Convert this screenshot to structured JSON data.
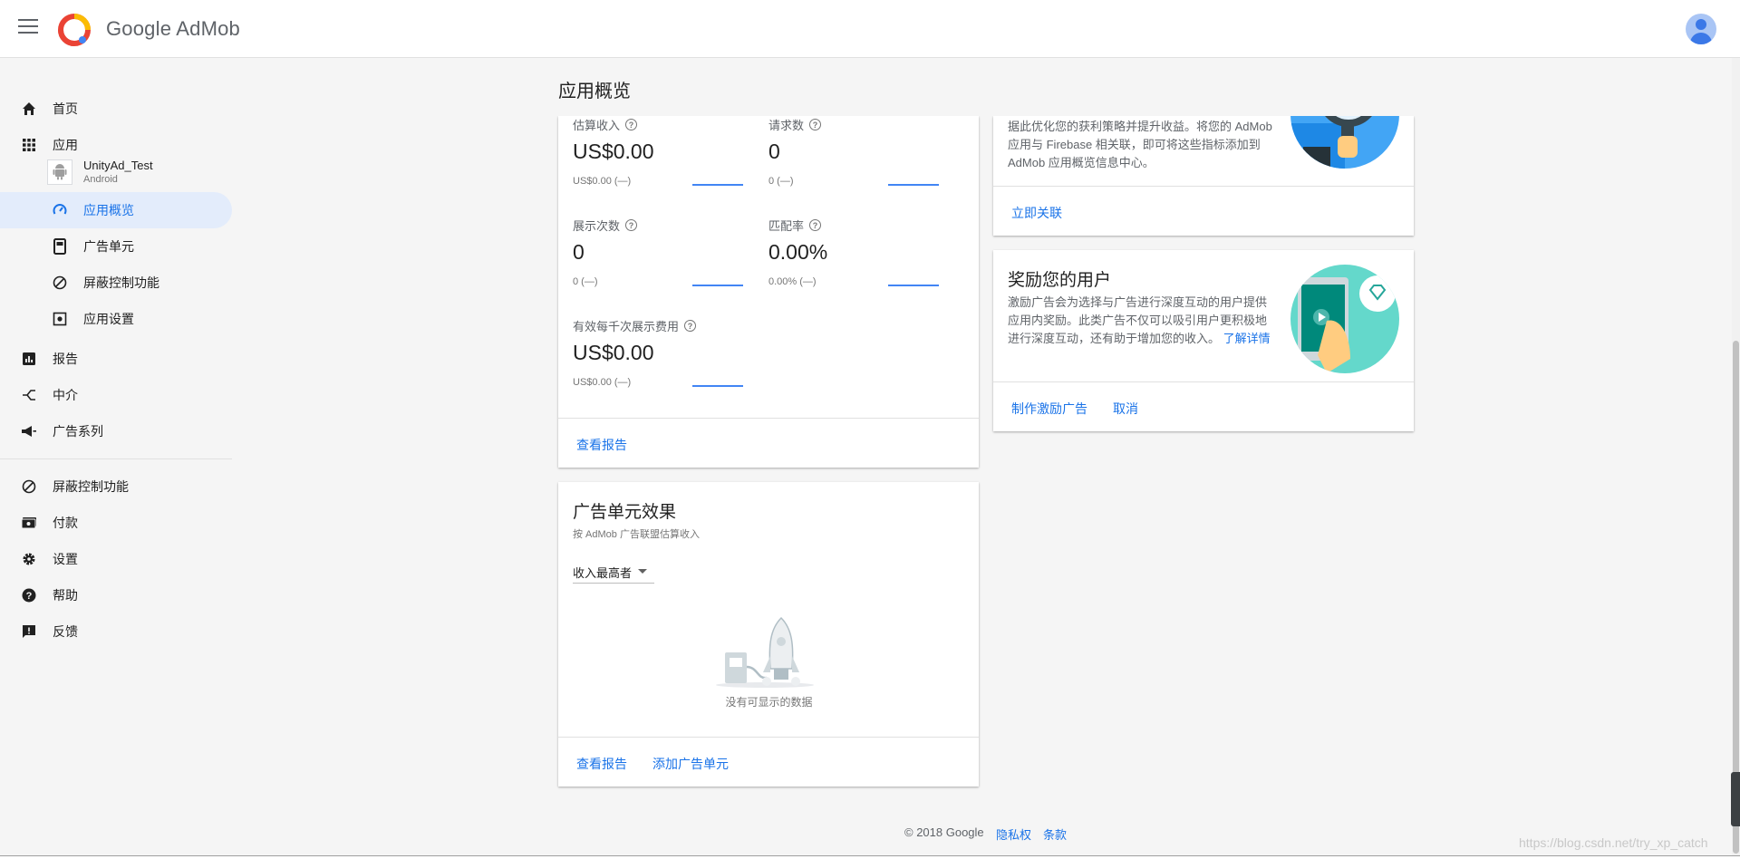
{
  "topbar": {
    "brand_google": "Google",
    "brand_product": "AdMob"
  },
  "sidebar": {
    "items": [
      {
        "label": "首页",
        "icon": "home-icon"
      },
      {
        "label": "应用",
        "icon": "apps-grid-icon"
      },
      {
        "label": "应用概览",
        "icon": "speed-gauge-icon"
      },
      {
        "label": "广告单元",
        "icon": "ad-unit-icon"
      },
      {
        "label": "屏蔽控制功能",
        "icon": "block-icon"
      },
      {
        "label": "应用设置",
        "icon": "app-settings-icon"
      },
      {
        "label": "报告",
        "icon": "report-icon"
      },
      {
        "label": "中介",
        "icon": "mediation-icon"
      },
      {
        "label": "广告系列",
        "icon": "campaign-icon"
      },
      {
        "label": "屏蔽控制功能",
        "icon": "block-icon"
      },
      {
        "label": "付款",
        "icon": "payments-icon"
      },
      {
        "label": "设置",
        "icon": "settings-icon"
      },
      {
        "label": "帮助",
        "icon": "help-icon"
      },
      {
        "label": "反馈",
        "icon": "feedback-icon"
      }
    ],
    "app": {
      "name": "UnityAd_Test",
      "platform": "Android"
    }
  },
  "page": {
    "title": "应用概览"
  },
  "metrics_card": {
    "metrics": [
      {
        "label": "估算收入",
        "value": "US$0.00",
        "sub": "US$0.00 (—)"
      },
      {
        "label": "请求数",
        "value": "0",
        "sub": "0 (—)"
      },
      {
        "label": "展示次数",
        "value": "0",
        "sub": "0 (—)"
      },
      {
        "label": "匹配率",
        "value": "0.00%",
        "sub": "0.00% (—)"
      },
      {
        "label": "有效每千次展示费用",
        "value": "US$0.00",
        "sub": "US$0.00 (—)"
      }
    ],
    "view_report": "查看报告"
  },
  "ad_unit_card": {
    "title": "广告单元效果",
    "subtitle": "按 AdMob 广告联盟估算收入",
    "dropdown_value": "收入最高者",
    "empty_text": "没有可显示的数据",
    "view_report": "查看报告",
    "add_ad_unit": "添加广告单元"
  },
  "firebase_card": {
    "desc_line1": "据此优化您的获利策略并提升收益。将您的 AdMob",
    "desc_line2": "应用与 Firebase 相关联，即可将这些指标添加到",
    "desc_line3": "AdMob 应用概览信息中心。",
    "action": "立即关联"
  },
  "reward_card": {
    "title": "奖励您的用户",
    "desc_line1": "激励广告会为选择与广告进行深度互动的用户提供",
    "desc_line2": "应用内奖励。此类广告不仅可以吸引用户更积极地",
    "desc_line3": "进行深度互动，还有助于增加您的收入。",
    "learn_more": "了解详情",
    "action_create": "制作激励广告",
    "action_cancel": "取消"
  },
  "footer": {
    "copyright": "© 2018 Google",
    "privacy": "隐私权",
    "terms": "条款"
  },
  "watermark": "https://blog.csdn.net/try_xp_catch",
  "colors": {
    "accent": "#1a73e8",
    "active_bg": "#e3ecfb",
    "spark": "#4285f4"
  }
}
